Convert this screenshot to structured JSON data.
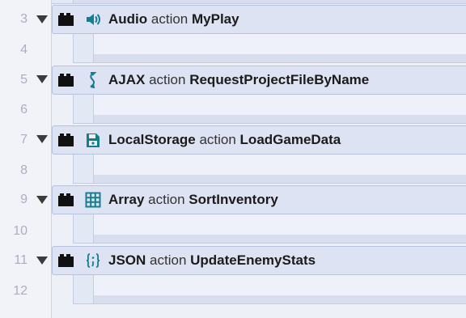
{
  "rows": [
    {
      "num": "3",
      "object": "Audio",
      "keyword": "action",
      "action": "MyPlay",
      "icon": "speaker-icon",
      "sub_num": "4"
    },
    {
      "num": "5",
      "object": "AJAX",
      "keyword": "action",
      "action": "RequestProjectFileByName",
      "icon": "ajax-icon",
      "sub_num": "6"
    },
    {
      "num": "7",
      "object": "LocalStorage",
      "keyword": "action",
      "action": "LoadGameData",
      "icon": "local-storage-icon",
      "sub_num": "8"
    },
    {
      "num": "9",
      "object": "Array",
      "keyword": "action",
      "action": "SortInventory",
      "icon": "array-grid-icon",
      "sub_num": "10"
    },
    {
      "num": "11",
      "object": "JSON",
      "keyword": "action",
      "action": "UpdateEnemyStats",
      "icon": "json-braces-icon",
      "sub_num": "12"
    }
  ],
  "colors": {
    "icon_teal": "#127f91",
    "block": "#111111"
  }
}
